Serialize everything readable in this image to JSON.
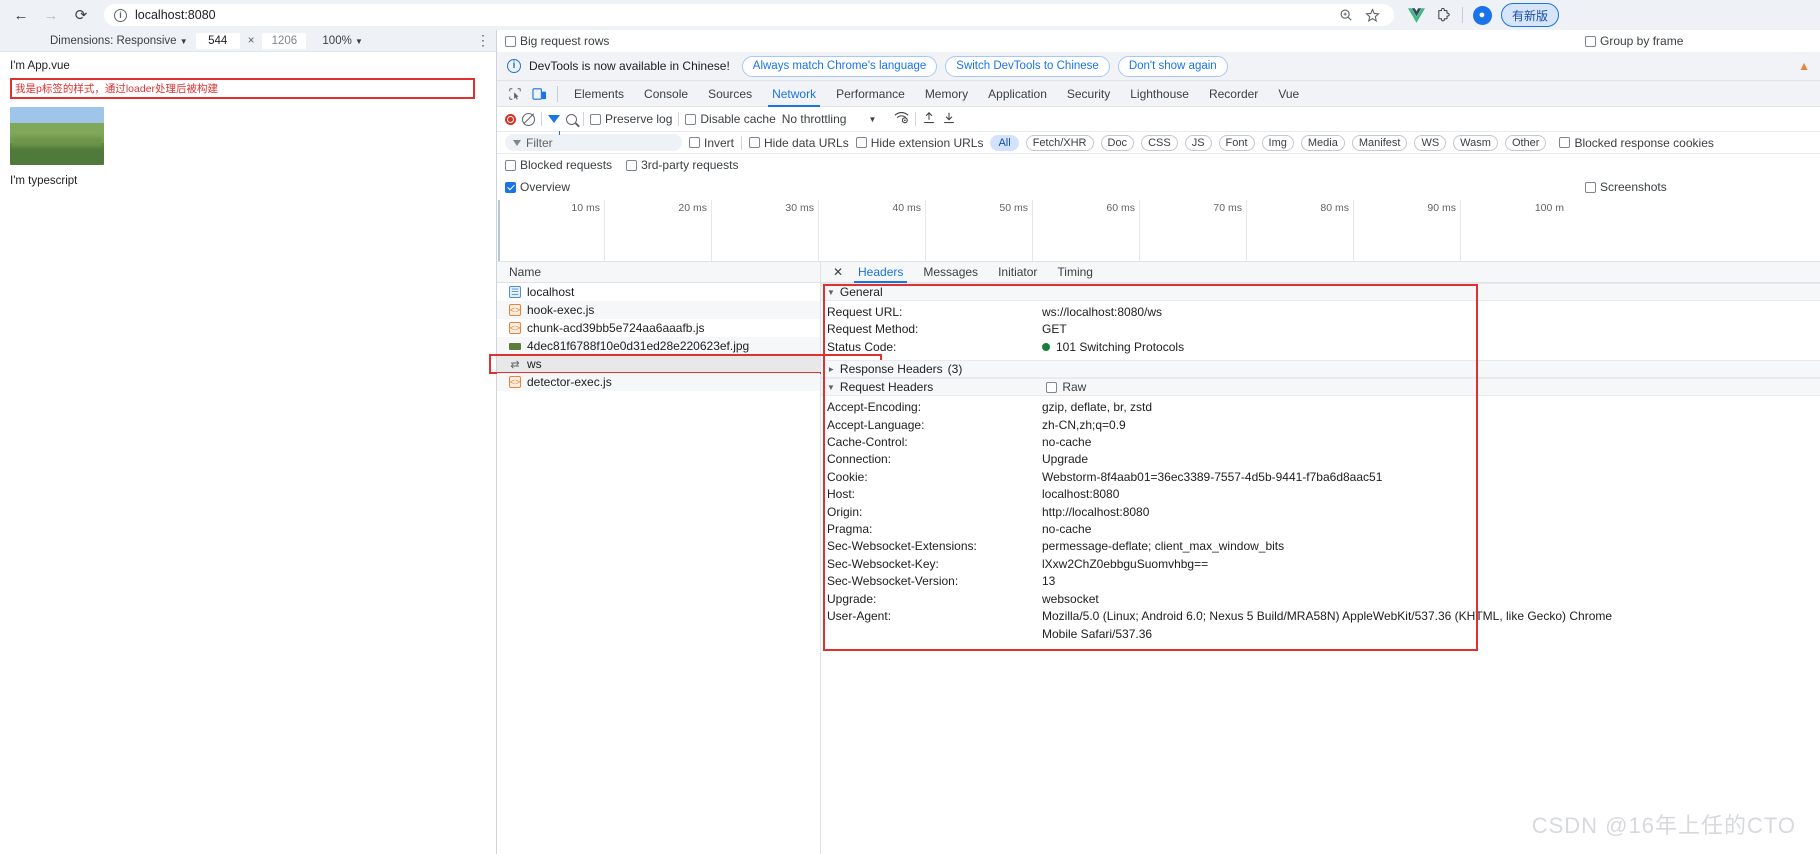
{
  "browser": {
    "back_icon": "back-arrow-icon",
    "forward_icon": "forward-arrow-icon",
    "reload_icon": "reload-icon",
    "site_info_icon": "info-circle-icon",
    "url": "localhost:8080",
    "zoom_icon": "zoom-search-icon",
    "bookmark_icon": "star-icon",
    "vue_ext_icon": "vue-devtools-icon",
    "extensions_icon": "extensions-puzzle-icon",
    "profile_icon": "profile-avatar-icon",
    "update_button": "有新版"
  },
  "device_toolbar": {
    "dimensions_label": "Dimensions: Responsive",
    "width": "544",
    "height": "1206",
    "zoom": "100%",
    "menu_icon": "kebab-menu-icon"
  },
  "page_preview": {
    "app_line": "I'm App.vue",
    "red_note": "我是p标签的样式，通过loader处理后被构建",
    "image_alt": "landscape-thumbnail",
    "typescript_line": "I'm typescript"
  },
  "devtools": {
    "banner": {
      "info_icon": "info-circle-icon",
      "message": "DevTools is now available in Chinese!",
      "buttons": [
        "Always match Chrome's language",
        "Switch DevTools to Chinese",
        "Don't show again"
      ],
      "warning_icon": "warning-triangle-icon"
    },
    "inspect_icon": "inspect-element-icon",
    "device_toggle_icon": "device-toolbar-icon",
    "tabs": [
      {
        "label": "Elements",
        "selected": false
      },
      {
        "label": "Console",
        "selected": false
      },
      {
        "label": "Sources",
        "selected": false
      },
      {
        "label": "Network",
        "selected": true
      },
      {
        "label": "Performance",
        "selected": false
      },
      {
        "label": "Memory",
        "selected": false
      },
      {
        "label": "Application",
        "selected": false
      },
      {
        "label": "Security",
        "selected": false
      },
      {
        "label": "Lighthouse",
        "selected": false
      },
      {
        "label": "Recorder",
        "selected": false
      },
      {
        "label": "Vue",
        "selected": false
      }
    ],
    "network_toolbar": {
      "record_icon": "record-stop-icon",
      "clear_icon": "clear-network-icon",
      "filter_icon": "filter-funnel-icon",
      "search_icon": "search-icon",
      "preserve_log": "Preserve log",
      "preserve_log_checked": false,
      "disable_cache": "Disable cache",
      "disable_cache_checked": false,
      "throttling": "No throttling",
      "wifi_icon": "network-conditions-icon",
      "import_icon": "import-har-icon",
      "export_icon": "export-har-icon"
    },
    "filter_row": {
      "filter_placeholder": "Filter",
      "invert": "Invert",
      "invert_checked": false,
      "hide_data_urls": "Hide data URLs",
      "hide_data_urls_checked": false,
      "hide_extension_urls": "Hide extension URLs",
      "hide_extension_urls_checked": false,
      "types": [
        "All",
        "Fetch/XHR",
        "Doc",
        "CSS",
        "JS",
        "Font",
        "Img",
        "Media",
        "Manifest",
        "WS",
        "Wasm",
        "Other"
      ],
      "selected_type": "All",
      "blocked_response_cookies": "Blocked response cookies",
      "blocked_response_cookies_checked": false
    },
    "options_row": {
      "blocked_requests": "Blocked requests",
      "blocked_requests_checked": false,
      "third_party_requests": "3rd-party requests",
      "third_party_requests_checked": false,
      "big_request_rows": "Big request rows",
      "big_request_rows_checked": false,
      "overview": "Overview",
      "overview_checked": true,
      "group_by_frame": "Group by frame",
      "group_by_frame_checked": false,
      "screenshots": "Screenshots",
      "screenshots_checked": false
    },
    "overview_ticks": [
      "10 ms",
      "20 ms",
      "30 ms",
      "40 ms",
      "50 ms",
      "60 ms",
      "70 ms",
      "80 ms",
      "90 ms",
      "100 m"
    ],
    "request_list": {
      "column_header": "Name",
      "rows": [
        {
          "name": "localhost",
          "icon": "document-icon",
          "selected": false
        },
        {
          "name": "hook-exec.js",
          "icon": "script-icon",
          "selected": false
        },
        {
          "name": "chunk-acd39bb5e724aa6aaafb.js",
          "icon": "script-icon",
          "selected": false
        },
        {
          "name": "4dec81f6788f10e0d31ed28e220623ef.jpg",
          "icon": "image-icon",
          "selected": false
        },
        {
          "name": "ws",
          "icon": "websocket-icon",
          "selected": true
        },
        {
          "name": "detector-exec.js",
          "icon": "script-icon",
          "selected": false
        }
      ]
    },
    "detail": {
      "close_icon": "close-icon",
      "tabs": [
        {
          "label": "Headers",
          "selected": true
        },
        {
          "label": "Messages",
          "selected": false
        },
        {
          "label": "Initiator",
          "selected": false
        },
        {
          "label": "Timing",
          "selected": false
        }
      ],
      "general": {
        "title": "General",
        "rows": [
          {
            "key": "Request URL:",
            "value": "ws://localhost:8080/ws"
          },
          {
            "key": "Request Method:",
            "value": "GET"
          },
          {
            "key": "Status Code:",
            "value": "101 Switching Protocols",
            "status": true
          }
        ]
      },
      "response_headers": {
        "title": "Response Headers",
        "count": "(3)"
      },
      "request_headers": {
        "title": "Request Headers",
        "raw_label": "Raw",
        "raw_checked": false,
        "rows": [
          {
            "key": "Accept-Encoding:",
            "value": "gzip, deflate, br, zstd"
          },
          {
            "key": "Accept-Language:",
            "value": "zh-CN,zh;q=0.9"
          },
          {
            "key": "Cache-Control:",
            "value": "no-cache"
          },
          {
            "key": "Connection:",
            "value": "Upgrade"
          },
          {
            "key": "Cookie:",
            "value": "Webstorm-8f4aab01=36ec3389-7557-4d5b-9441-f7ba6d8aac51"
          },
          {
            "key": "Host:",
            "value": "localhost:8080"
          },
          {
            "key": "Origin:",
            "value": "http://localhost:8080"
          },
          {
            "key": "Pragma:",
            "value": "no-cache"
          },
          {
            "key": "Sec-Websocket-Extensions:",
            "value": "permessage-deflate; client_max_window_bits"
          },
          {
            "key": "Sec-Websocket-Key:",
            "value": "lXxw2ChZ0ebbguSuomvhbg=="
          },
          {
            "key": "Sec-Websocket-Version:",
            "value": "13"
          },
          {
            "key": "Upgrade:",
            "value": "websocket"
          },
          {
            "key": "User-Agent:",
            "value": "Mozilla/5.0 (Linux; Android 6.0; Nexus 5 Build/MRA58N) AppleWebKit/537.36 (KHTML, like Gecko) Chrome"
          },
          {
            "key": "",
            "value": "Mobile Safari/537.36"
          }
        ]
      }
    }
  },
  "watermark": "CSDN @16年上任的CTO",
  "colors": {
    "accent": "#1a73e8",
    "red_highlight": "#e03131",
    "status_green": "#178038",
    "chrome_bg": "#eef1f6"
  }
}
